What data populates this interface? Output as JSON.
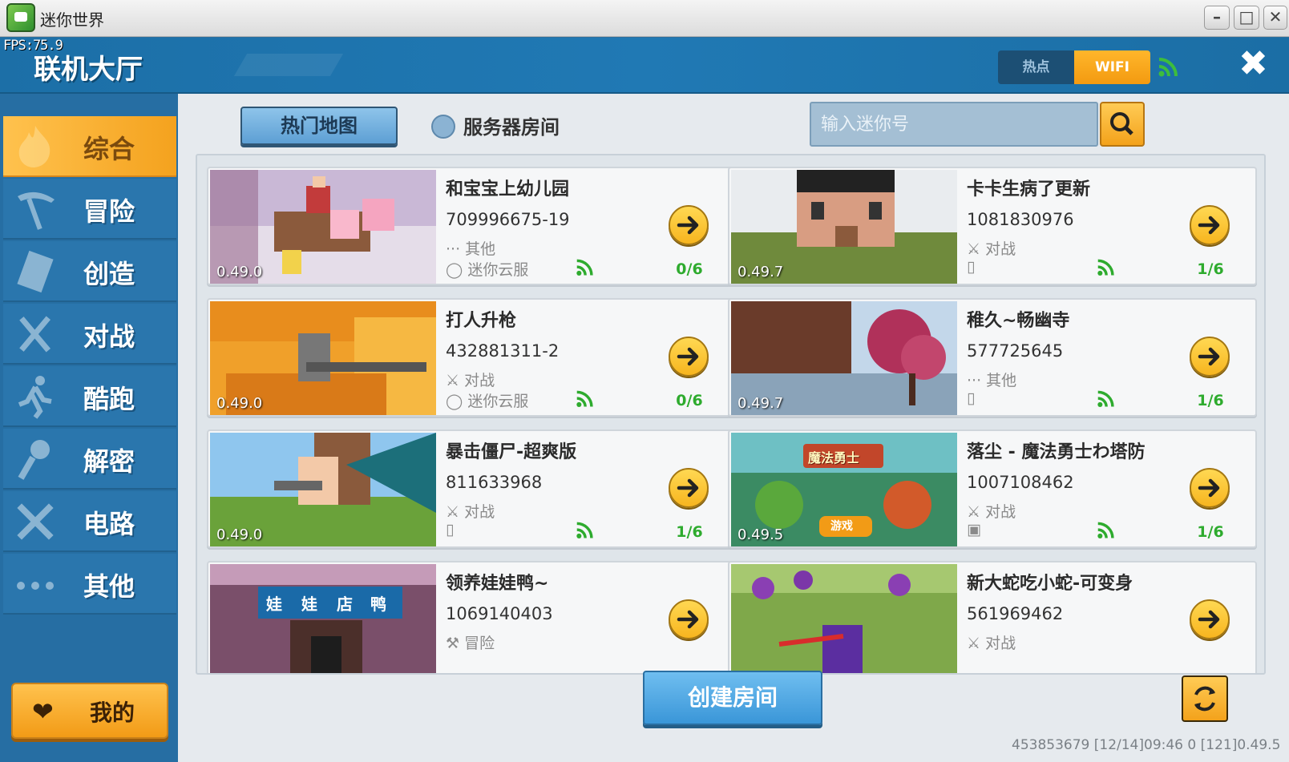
{
  "window": {
    "title": "迷你世界",
    "fps": "FPS:75.9"
  },
  "header": {
    "title": "联机大厅",
    "network": {
      "hotspot": "热点",
      "wifi": "WIFI"
    }
  },
  "sidebar": {
    "items": [
      {
        "label": "综合",
        "icon": "flame-icon",
        "active": true
      },
      {
        "label": "冒险",
        "icon": "pickaxe-icon"
      },
      {
        "label": "创造",
        "icon": "block-icon"
      },
      {
        "label": "对战",
        "icon": "swords-icon"
      },
      {
        "label": "酷跑",
        "icon": "runner-icon"
      },
      {
        "label": "解密",
        "icon": "key-icon"
      },
      {
        "label": "电路",
        "icon": "tools-icon"
      },
      {
        "label": "其他",
        "icon": "more-icon"
      }
    ],
    "my_button": "我的"
  },
  "toolbar": {
    "hot_maps_tab": "热门地图",
    "server_rooms_label": "服务器房间",
    "search_placeholder": "输入迷你号"
  },
  "rooms": [
    {
      "title": "和宝宝上幼儿园",
      "id": "709996675-19",
      "type": "其他",
      "server": "迷你云服",
      "version": "0.49.0",
      "count": "0/6"
    },
    {
      "title": "卡卡生病了更新",
      "id": "1081830976",
      "type": "对战",
      "server": "",
      "version": "0.49.7",
      "count": "1/6"
    },
    {
      "title": "打人升枪",
      "id": "432881311-2",
      "type": "对战",
      "server": "迷你云服",
      "version": "0.49.0",
      "count": "0/6"
    },
    {
      "title": "稚久~畅幽寺",
      "id": "577725645",
      "type": "其他",
      "server": "",
      "version": "0.49.7",
      "count": "1/6"
    },
    {
      "title": "暴击僵尸-超爽版",
      "id": "811633968",
      "type": "对战",
      "server": "",
      "version": "0.49.0",
      "count": "1/6"
    },
    {
      "title": "落尘 - 魔法勇士わ塔防",
      "id": "1007108462",
      "type": "对战",
      "server": "",
      "version": "0.49.5",
      "count": "1/6",
      "thumb_title": "魔法勇士",
      "thumb_badge": "游戏"
    },
    {
      "title": "领养娃娃鸭~",
      "id": "1069140403",
      "type": "冒险",
      "server": "",
      "version": "",
      "count": "",
      "thumb_sign": [
        "娃",
        "娃",
        "店",
        "鸭"
      ]
    },
    {
      "title": "新大蛇吃小蛇-可变身",
      "id": "561969462",
      "type": "对战",
      "server": "",
      "version": "",
      "count": ""
    }
  ],
  "actions": {
    "create_room": "创建房间"
  },
  "footer": {
    "info": "453853679  [12/14]09:46 0  [121]0.49.5"
  },
  "colors": {
    "accent_orange": "#f4a21e",
    "header_blue": "#2079b4",
    "signal_green": "#2eab2e"
  }
}
